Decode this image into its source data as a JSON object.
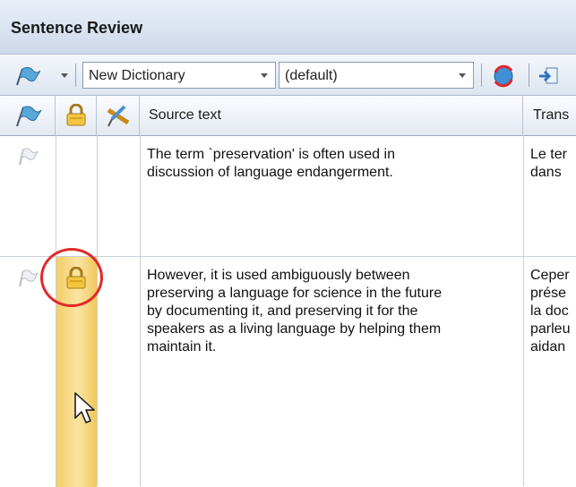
{
  "window": {
    "title": "Sentence Review"
  },
  "toolbar": {
    "dictionary_value": "New Dictionary",
    "profile_value": "(default)"
  },
  "table": {
    "headers": {
      "source": "Source text",
      "target": "Trans"
    },
    "rows": [
      {
        "source_lines": [
          "The term `preservation' is often used in",
          "discussion of language endangerment."
        ],
        "target_lines": [
          "Le ter",
          "dans"
        ],
        "locked": false
      },
      {
        "source_lines": [
          "However, it is used ambiguously between",
          "preserving a language for science in the future",
          "by documenting it, and preserving it for the",
          "speakers as a living language by helping them",
          "maintain it."
        ],
        "target_lines": [
          "Ceper",
          "prése",
          "la doc",
          "parleu",
          "aidan"
        ],
        "locked": true
      }
    ]
  },
  "colors": {
    "highlight": "#f6d679",
    "annotation_ring": "#e12a2a"
  }
}
